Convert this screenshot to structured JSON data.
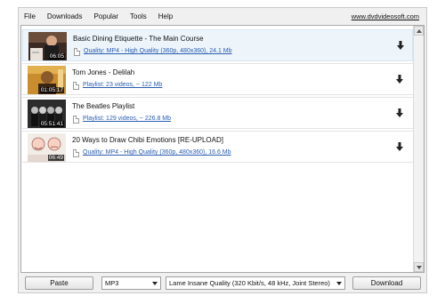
{
  "menu": {
    "items": [
      "File",
      "Downloads",
      "Popular",
      "Tools",
      "Help"
    ],
    "site_link": "www.dvdvideosoft.com"
  },
  "downloads": [
    {
      "title": "Basic Dining Etiquette - The Main Course",
      "info": "Quality: MP4 - High Quality (360p, 480x360), 24.1 Mb",
      "duration": "06:05"
    },
    {
      "title": "Tom Jones - Delilah",
      "info": "Playlist: 23 videos, ~ 122 Mb",
      "duration": "01:05:17"
    },
    {
      "title": "The Beatles Playlist",
      "info": "Playlist: 129 videos, ~ 226.8 Mb",
      "duration": "05:51:41"
    },
    {
      "title": "20 Ways to Draw Chibi Emotions [RE-UPLOAD]",
      "info": "Quality: MP4 - High Quality (360p, 480x360), 16.6 Mb",
      "duration": "06:49"
    }
  ],
  "toolbar": {
    "paste_label": "Paste",
    "format_value": "MP3",
    "quality_value": "Lame Insane Quality (320 Kbit/s, 48 kHz, Joint Stereo)",
    "download_label": "Download"
  },
  "icons": {
    "download": "download-arrow-icon",
    "close": "close-icon",
    "file": "file-icon",
    "dropdown": "chevron-down-icon"
  },
  "colors": {
    "link": "#2a5db0",
    "selected_row": "#edf5fb"
  }
}
